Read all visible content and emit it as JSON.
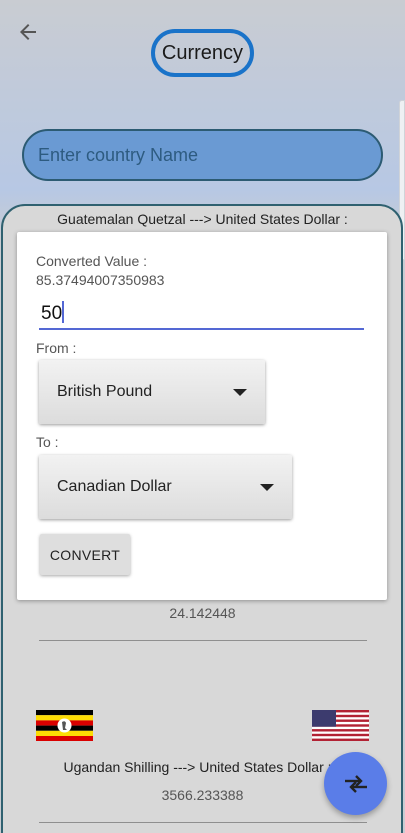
{
  "header": {
    "title": "Currency"
  },
  "search": {
    "placeholder": "Enter country Name"
  },
  "list": {
    "rows": [
      {
        "title": "Guatemalan Quetzal ---> United States Dollar :",
        "value": "24.142448"
      },
      {
        "title": "Ugandan Shilling ---> United States Dollar :",
        "value": "3566.233388"
      }
    ]
  },
  "dialog": {
    "converted_label": "Converted Value :",
    "converted_value": "85.37494007350983",
    "amount": "50",
    "from_label": "From :",
    "from_value": "British Pound",
    "to_label": "To :",
    "to_value": "Canadian Dollar",
    "convert_label": "CONVERT"
  },
  "icons": {
    "back": "arrow-back-icon",
    "dropdown": "triangle-down-icon",
    "fab": "swap-arrows-icon",
    "flags": [
      "uganda-flag-icon",
      "usa-flag-icon"
    ]
  },
  "colors": {
    "accent": "#1a73c9",
    "search_fill": "#6a9ad3",
    "fab": "#5a7de8",
    "underline": "#5468d4"
  }
}
